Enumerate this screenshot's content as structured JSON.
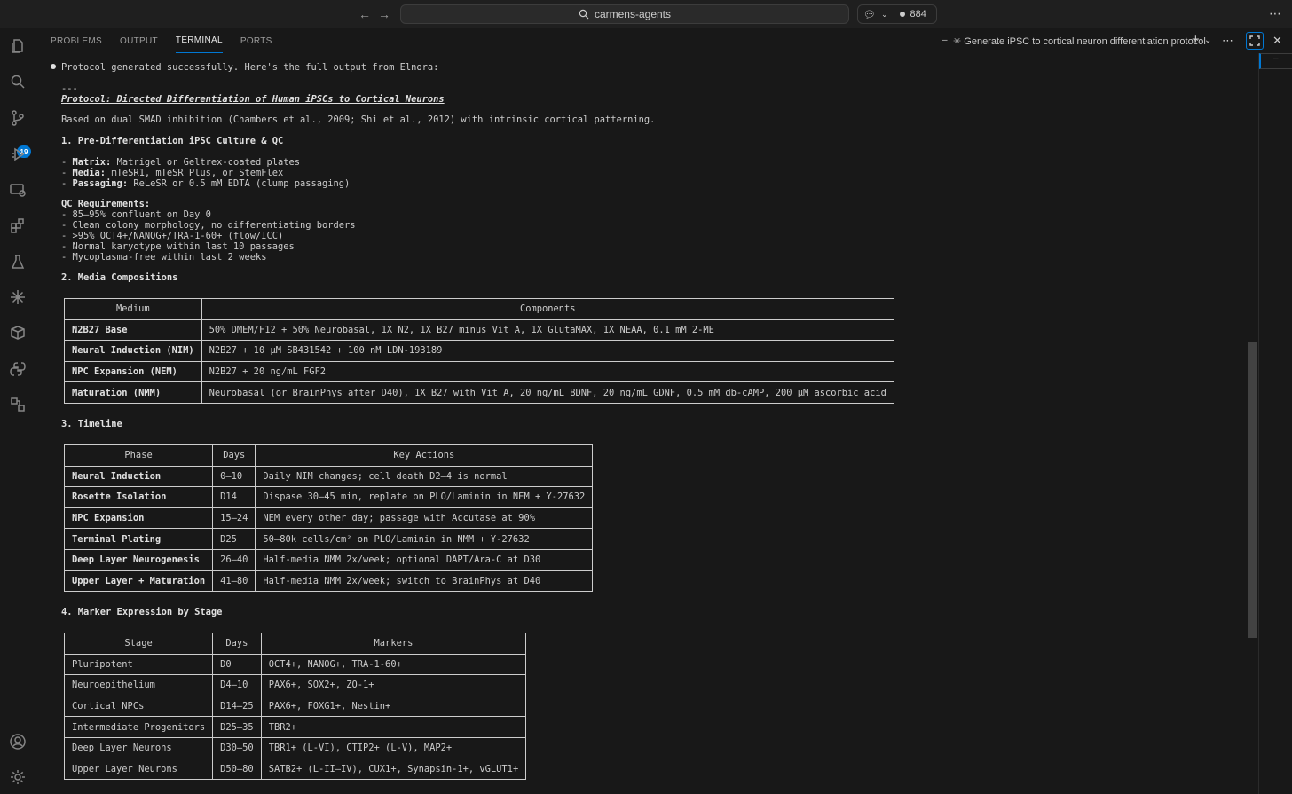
{
  "titlebar": {
    "search_text": "carmens-agents",
    "counter": "884"
  },
  "panel": {
    "tabs": [
      "PROBLEMS",
      "OUTPUT",
      "TERMINAL",
      "PORTS"
    ],
    "active_tab": "TERMINAL",
    "terminal_title": "✳ Generate iPSC to cortical neuron differentiation protocol",
    "right_tab_label": "–"
  },
  "activity": {
    "source_control_badge": "19"
  },
  "output": {
    "status_line": "Protocol generated successfully. Here's the full output from Elnora:",
    "rule": "---",
    "heading": "Protocol: Directed Differentiation of Human iPSCs to Cortical Neurons",
    "intro": "Based on dual SMAD inhibition (Chambers et al., 2009; Shi et al., 2012) with intrinsic cortical patterning.",
    "s1_title": "1. Pre-Differentiation iPSC Culture & QC",
    "s1_items": [
      {
        "label": "Matrix:",
        "text": " Matrigel or Geltrex-coated plates"
      },
      {
        "label": "Media:",
        "text": " mTeSR1, mTeSR Plus, or StemFlex"
      },
      {
        "label": "Passaging:",
        "text": " ReLeSR or 0.5 mM EDTA (clump passaging)"
      }
    ],
    "qc_title": "QC Requirements:",
    "qc_items": [
      "- 85–95% confluent on Day 0",
      "- Clean colony morphology, no differentiating borders",
      "- >95% OCT4+/NANOG+/TRA-1-60+ (flow/ICC)",
      "- Normal karyotype within last 10 passages",
      "- Mycoplasma-free within last 2 weeks"
    ],
    "s2_title": "2. Media Compositions",
    "media_table": {
      "headers": [
        "Medium",
        "Components"
      ],
      "rows": [
        [
          "N2B27 Base",
          "50% DMEM/F12 + 50% Neurobasal, 1X N2, 1X B27 minus Vit A, 1X GlutaMAX, 1X NEAA, 0.1 mM 2-ME"
        ],
        [
          "Neural Induction (NIM)",
          "N2B27 + 10 µM SB431542 + 100 nM LDN-193189"
        ],
        [
          "NPC Expansion (NEM)",
          "N2B27 + 20 ng/mL FGF2"
        ],
        [
          "Maturation (NMM)",
          "Neurobasal (or BrainPhys after D40), 1X B27 with Vit A, 20 ng/mL BDNF, 20 ng/mL GDNF, 0.5 mM db-cAMP, 200 µM ascorbic acid"
        ]
      ]
    },
    "s3_title": "3. Timeline",
    "timeline_table": {
      "headers": [
        "Phase",
        "Days",
        "Key Actions"
      ],
      "rows": [
        [
          "Neural Induction",
          "0–10",
          "Daily NIM changes; cell death D2–4 is normal"
        ],
        [
          "Rosette Isolation",
          "D14",
          "Dispase 30–45 min, replate on PLO/Laminin in NEM + Y-27632"
        ],
        [
          "NPC Expansion",
          "15–24",
          "NEM every other day; passage with Accutase at 90%"
        ],
        [
          "Terminal Plating",
          "D25",
          "50–80k cells/cm² on PLO/Laminin in NMM + Y-27632"
        ],
        [
          "Deep Layer Neurogenesis",
          "26–40",
          "Half-media NMM 2x/week; optional DAPT/Ara-C at D30"
        ],
        [
          "Upper Layer + Maturation",
          "41–80",
          "Half-media NMM 2x/week; switch to BrainPhys at D40"
        ]
      ]
    },
    "s4_title": "4. Marker Expression by Stage",
    "marker_table": {
      "headers": [
        "Stage",
        "Days",
        "Markers"
      ],
      "rows": [
        [
          "Pluripotent",
          "D0",
          "OCT4+, NANOG+, TRA-1-60+"
        ],
        [
          "Neuroepithelium",
          "D4–10",
          "PAX6+, SOX2+, ZO-1+"
        ],
        [
          "Cortical NPCs",
          "D14–25",
          "PAX6+, FOXG1+, Nestin+"
        ],
        [
          "Intermediate Progenitors",
          "D25–35",
          "TBR2+"
        ],
        [
          "Deep Layer Neurons",
          "D30–50",
          "TBR1+ (L-VI), CTIP2+ (L-V), MAP2+"
        ],
        [
          "Upper Layer Neurons",
          "D50–80",
          "SATB2+ (L-II–IV), CUX1+, Synapsin-1+, vGLUT1+"
        ]
      ]
    }
  }
}
